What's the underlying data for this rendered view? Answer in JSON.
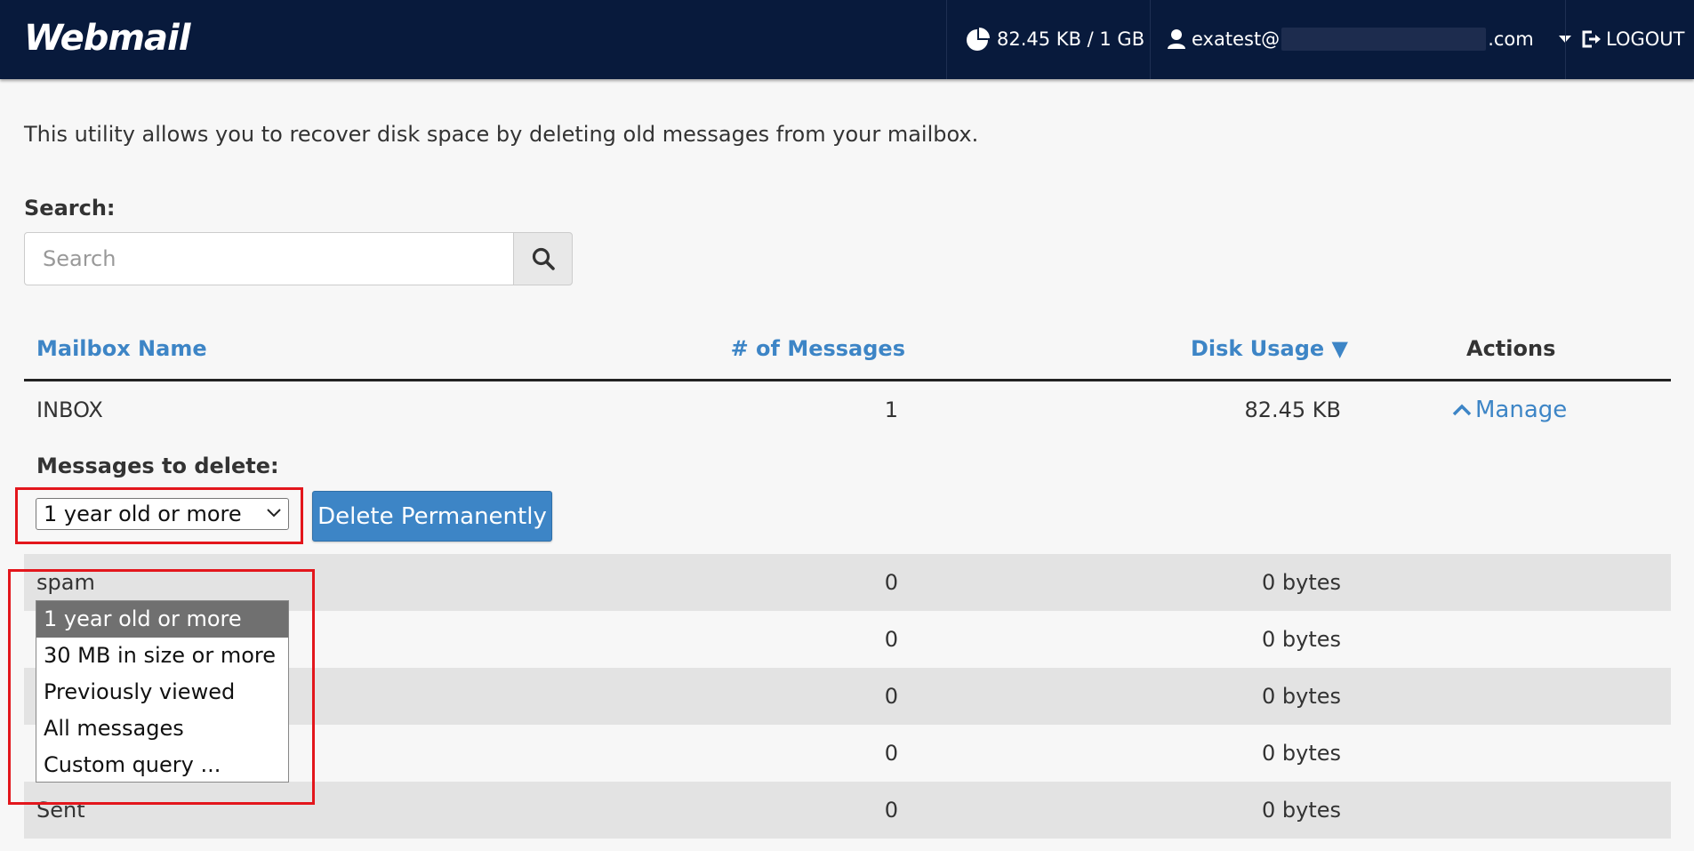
{
  "header": {
    "logo": "Webmail",
    "quota": "82.45 KB / 1 GB",
    "user_prefix": "exatest@",
    "user_suffix": ".com",
    "logout": "LOGOUT"
  },
  "intro": "This utility allows you to recover disk space by deleting old messages from your mailbox.",
  "search": {
    "label": "Search:",
    "placeholder": "Search"
  },
  "table": {
    "headers": {
      "name": "Mailbox Name",
      "count": "# of Messages",
      "usage": "Disk Usage ▼",
      "actions": "Actions"
    },
    "rows": [
      {
        "name": "INBOX",
        "count": "1",
        "usage": "82.45 KB",
        "action": "Manage"
      },
      {
        "name": "spam",
        "count": "0",
        "usage": "0 bytes"
      },
      {
        "name": "",
        "count": "0",
        "usage": "0 bytes"
      },
      {
        "name": "",
        "count": "0",
        "usage": "0 bytes"
      },
      {
        "name": "",
        "count": "0",
        "usage": "0 bytes"
      },
      {
        "name": "Sent",
        "count": "0",
        "usage": "0 bytes"
      }
    ]
  },
  "manage_panel": {
    "label": "Messages to delete:",
    "selected": "1 year old or more",
    "options": [
      "1 year old or more",
      "30 MB in size or more",
      "Previously viewed",
      "All messages",
      "Custom query ..."
    ],
    "delete_button": "Delete Permanently"
  },
  "colors": {
    "header_bg": "#081a3c",
    "link": "#3d85c6",
    "highlight_box": "#e3161c",
    "selected_option": "#707070"
  }
}
